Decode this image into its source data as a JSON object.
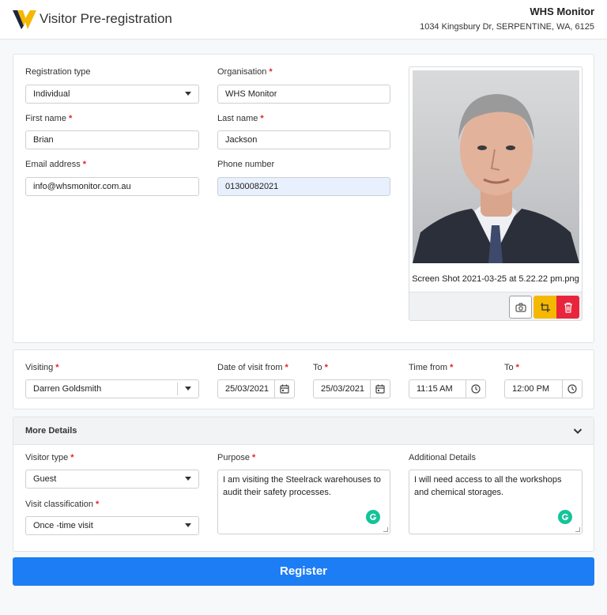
{
  "header": {
    "title": "Visitor Pre-registration",
    "org_name": "WHS Monitor",
    "org_address": "1034 Kingsbury Dr, SERPENTINE, WA, 6125"
  },
  "form": {
    "registration_type": {
      "label": "Registration type",
      "value": "Individual"
    },
    "organisation": {
      "label": "Organisation",
      "value": "WHS Monitor"
    },
    "first_name": {
      "label": "First name",
      "value": "Brian"
    },
    "last_name": {
      "label": "Last name",
      "value": "Jackson"
    },
    "email": {
      "label": "Email address",
      "value": "info@whsmonitor.com.au"
    },
    "phone": {
      "label": "Phone number",
      "value": "01300082021"
    }
  },
  "photo": {
    "filename": "Screen Shot 2021-03-25 at 5.22.22 pm.png"
  },
  "visit": {
    "visiting": {
      "label": "Visiting",
      "value": "Darren Goldsmith"
    },
    "date_from": {
      "label": "Date of visit from",
      "value": "25/03/2021"
    },
    "date_to": {
      "label": "To",
      "value": "25/03/2021"
    },
    "time_from": {
      "label": "Time from",
      "value": "11:15 AM"
    },
    "time_to": {
      "label": "To",
      "value": "12:00 PM"
    }
  },
  "more_details": {
    "title": "More Details",
    "visitor_type": {
      "label": "Visitor type",
      "value": "Guest"
    },
    "visit_classification": {
      "label": "Visit classification",
      "value": "Once -time visit"
    },
    "purpose": {
      "label": "Purpose",
      "value": "I am visiting the Steelrack warehouses to audit their safety processes."
    },
    "additional": {
      "label": "Additional Details",
      "value": "I will need access to all the workshops and chemical storages."
    }
  },
  "register_label": "Register",
  "colors": {
    "primary": "#1d7df5",
    "required": "#e02424",
    "warning": "#f5b800",
    "danger": "#e8253c"
  }
}
